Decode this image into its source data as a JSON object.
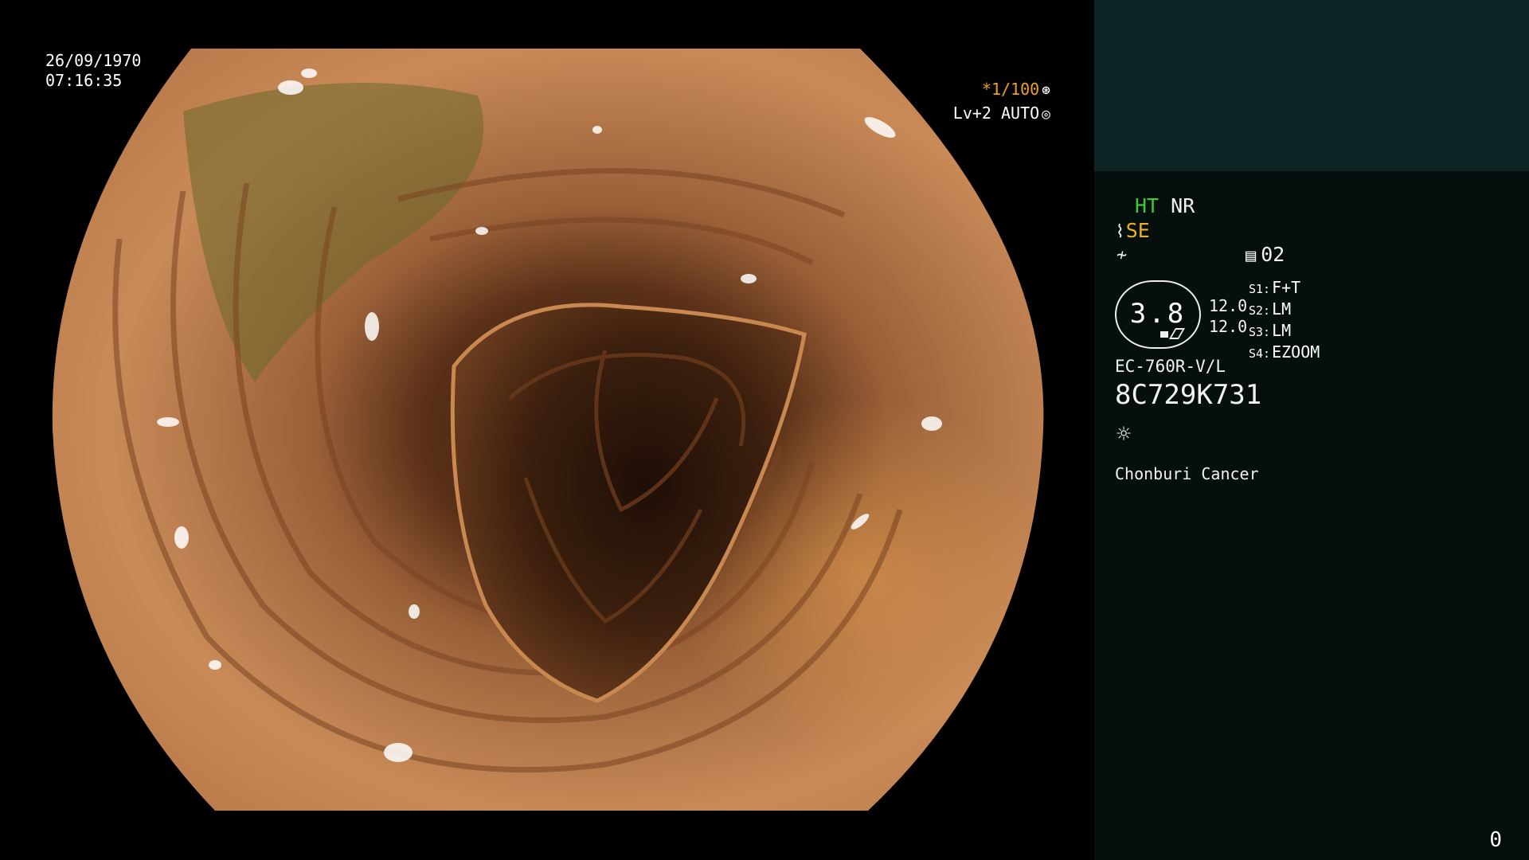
{
  "screen": {
    "date": "26/09/1970",
    "time": "07:16:35",
    "shutter": "*1/100",
    "shutter_icon": "shutter-icon",
    "level": "Lv+2 AUTO",
    "level_icon": "iris-icon"
  },
  "panel": {
    "ht": "HT",
    "nr": "NR",
    "se": "SE",
    "se_icon": "scope-tip-icon",
    "signal_icon": "signal-icon",
    "memo_icon": "memo-icon",
    "memo": "02",
    "zoom": "3.8",
    "zoom_left": "12.0",
    "zoom_right": "12.0",
    "s1_key": "S1:",
    "s1": "F+T",
    "s2_key": "S2:",
    "s2": "LM",
    "s3_key": "S3:",
    "s3": "LM",
    "s4_key": "S4:",
    "s4": "EZOOM",
    "model": "EC-760R-V/L",
    "serial": "8C729K731",
    "light_icon": "light-source-icon",
    "hospital": "Chonburi Cancer",
    "counter": "0"
  },
  "colors": {
    "panel_top": "#0f2425",
    "panel_bg": "#050f0e",
    "ht_green": "#3ec83e",
    "se_orange": "#f0b020"
  }
}
